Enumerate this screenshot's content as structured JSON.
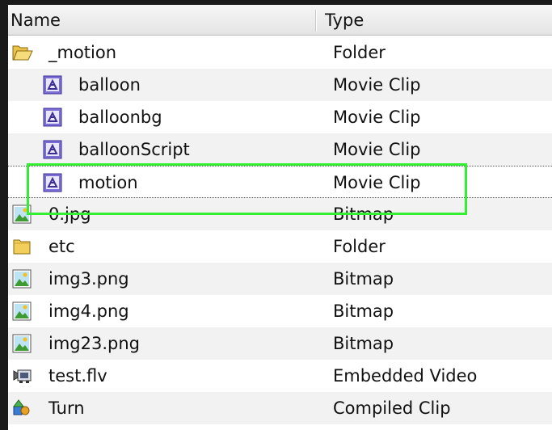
{
  "header": {
    "name_label": "Name",
    "type_label": "Type"
  },
  "rows": [
    {
      "label": "_motion",
      "type": "Folder",
      "icon": "folder-open-icon"
    },
    {
      "label": "balloon",
      "type": "Movie Clip",
      "icon": "movie-clip-icon"
    },
    {
      "label": "balloonbg",
      "type": "Movie Clip",
      "icon": "movie-clip-icon"
    },
    {
      "label": "balloonScript",
      "type": "Movie Clip",
      "icon": "movie-clip-icon"
    },
    {
      "label": "motion",
      "type": "Movie Clip",
      "icon": "movie-clip-icon"
    },
    {
      "label": "0.jpg",
      "type": "Bitmap",
      "icon": "bitmap-icon"
    },
    {
      "label": "etc",
      "type": "Folder",
      "icon": "folder-icon"
    },
    {
      "label": "img3.png",
      "type": "Bitmap",
      "icon": "bitmap-icon"
    },
    {
      "label": "img4.png",
      "type": "Bitmap",
      "icon": "bitmap-icon"
    },
    {
      "label": "img23.png",
      "type": "Bitmap",
      "icon": "bitmap-icon"
    },
    {
      "label": "test.flv",
      "type": "Embedded Video",
      "icon": "video-icon"
    },
    {
      "label": "Turn",
      "type": "Compiled Clip",
      "icon": "compiled-clip-icon"
    }
  ],
  "colors": {
    "highlight": "#33ee33",
    "alt_row": "#f2f2f2",
    "movie_clip": "#6a5acd"
  }
}
